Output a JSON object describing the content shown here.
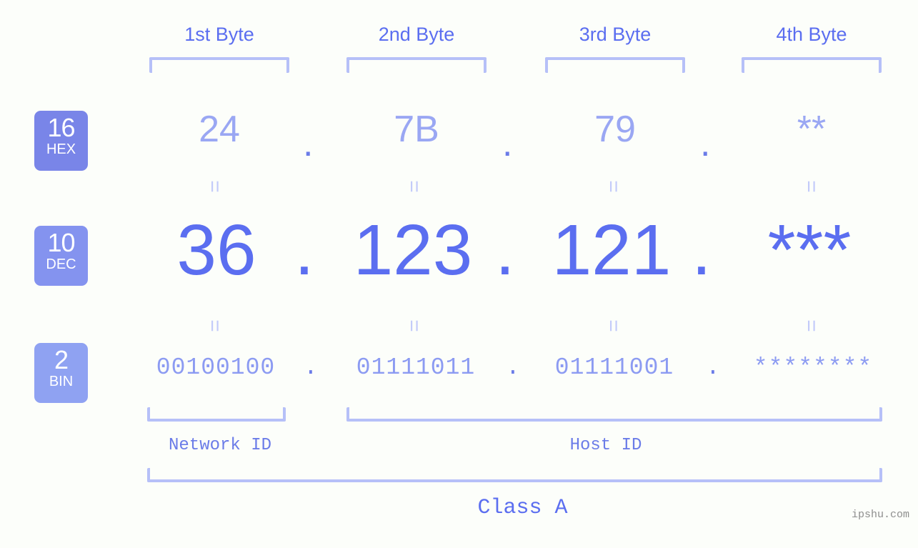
{
  "background_color": "#fcfefa",
  "accent_color": "#5b6ef0",
  "bracket_color": "#b6c0f8",
  "headers": [
    {
      "label": "1st Byte"
    },
    {
      "label": "2nd Byte"
    },
    {
      "label": "3rd Byte"
    },
    {
      "label": "4th Byte"
    }
  ],
  "rows": {
    "hex": {
      "badge_number": "16",
      "badge_base": "HEX",
      "badge_color": "#7985e8",
      "values": [
        "24",
        "7B",
        "79",
        "**"
      ],
      "separator": "."
    },
    "dec": {
      "badge_number": "10",
      "badge_base": "DEC",
      "badge_color": "#8493ef",
      "values": [
        "36",
        "123",
        "121",
        "***"
      ],
      "separator": "."
    },
    "bin": {
      "badge_number": "2",
      "badge_base": "BIN",
      "badge_color": "#8fa2f2",
      "values": [
        "00100100",
        "01111011",
        "01111001",
        "********"
      ],
      "separator": "."
    }
  },
  "equals_glyph": "=",
  "id_labels": {
    "network": "Network ID",
    "host": "Host ID"
  },
  "class_label": "Class A",
  "watermark": "ipshu.com"
}
